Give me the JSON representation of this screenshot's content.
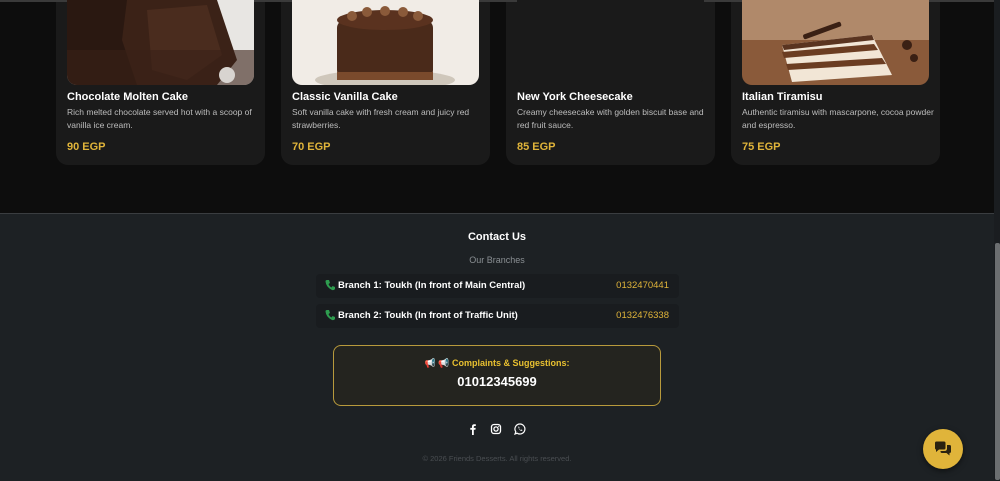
{
  "products": [
    {
      "name": "Chocolate Molten Cake",
      "description": "Rich melted chocolate served hot with a scoop of vanilla ice cream.",
      "price": "90 EGP",
      "image_icon": "chocolate-cake-image"
    },
    {
      "name": "Classic Vanilla Cake",
      "description": "Soft vanilla cake with fresh cream and juicy red strawberries.",
      "price": "70 EGP",
      "image_icon": "vanilla-cake-image"
    },
    {
      "name": "New York Cheesecake",
      "description": "Creamy cheesecake with golden biscuit base and red fruit sauce.",
      "price": "85 EGP",
      "image_icon": "cheesecake-image"
    },
    {
      "name": "Italian Tiramisu",
      "description": "Authentic tiramisu with mascarpone, cocoa powder and espresso.",
      "price": "75 EGP",
      "image_icon": "tiramisu-image"
    }
  ],
  "footer": {
    "contact_title": "Contact Us",
    "branches_title": "Our Branches",
    "branches": [
      {
        "label": "Branch 1: Toukh (In front of Main Central)",
        "phone": "0132470441"
      },
      {
        "label": "Branch 2: Toukh (In front of Traffic Unit)",
        "phone": "0132476338"
      }
    ],
    "complaints_label": "📢 📢 Complaints & Suggestions:",
    "complaints_phone": "01012345699",
    "social_icons": [
      "facebook-icon",
      "instagram-icon",
      "whatsapp-icon"
    ],
    "copyright": "© 2026 Friends Desserts. All rights reserved."
  },
  "colors": {
    "accent": "#e0b43a",
    "background": "#0d0d0d",
    "card": "#1a1a1a",
    "footer": "#1d2124",
    "phone_icon": "#2e9d4f"
  },
  "chat_button_icon": "chat-bubbles-icon"
}
